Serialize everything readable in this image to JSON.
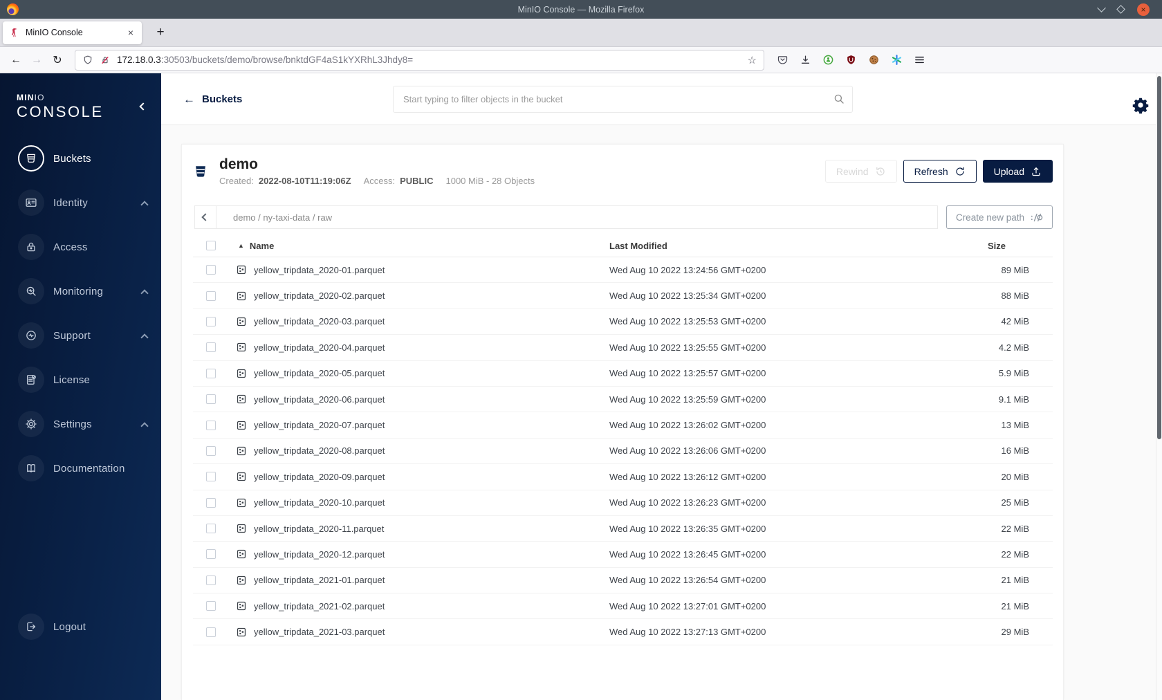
{
  "window": {
    "title": "MinIO Console — Mozilla Firefox"
  },
  "tab": {
    "title": "MinIO Console"
  },
  "urlbar": {
    "host": "172.18.0.3",
    "rest": ":30503/buckets/demo/browse/bnktdGF4aS1kYXRhL3Jhdy8="
  },
  "sidebar": {
    "logo": {
      "min": "MIN",
      "io": "IO",
      "console": "CONSOLE"
    },
    "items": [
      {
        "label": "Buckets",
        "icon": "buckets-icon",
        "active": true,
        "expandable": false
      },
      {
        "label": "Identity",
        "icon": "identity-icon",
        "active": false,
        "expandable": true
      },
      {
        "label": "Access",
        "icon": "access-lock-icon",
        "active": false,
        "expandable": false
      },
      {
        "label": "Monitoring",
        "icon": "monitoring-icon",
        "active": false,
        "expandable": true
      },
      {
        "label": "Support",
        "icon": "support-icon",
        "active": false,
        "expandable": true
      },
      {
        "label": "License",
        "icon": "license-icon",
        "active": false,
        "expandable": false
      },
      {
        "label": "Settings",
        "icon": "settings-gear-icon",
        "active": false,
        "expandable": true
      },
      {
        "label": "Documentation",
        "icon": "documentation-icon",
        "active": false,
        "expandable": false
      }
    ],
    "logout": {
      "label": "Logout",
      "icon": "logout-icon"
    }
  },
  "topbar": {
    "back_label": "Buckets",
    "search_placeholder": "Start typing to filter objects in the bucket"
  },
  "bucket": {
    "name": "demo",
    "created_label": "Created:",
    "created_value": "2022-08-10T11:19:06Z",
    "access_label": "Access:",
    "access_value": "PUBLIC",
    "usage": "1000 MiB - 28 Objects",
    "rewind_label": "Rewind",
    "refresh_label": "Refresh",
    "upload_label": "Upload"
  },
  "path": {
    "breadcrumb": "demo / ny-taxi-data / raw",
    "create_label": "Create new path"
  },
  "table": {
    "columns": {
      "name": "Name",
      "modified": "Last Modified",
      "size": "Size"
    },
    "rows": [
      {
        "name": "yellow_tripdata_2020-01.parquet",
        "modified": "Wed Aug 10 2022 13:24:56 GMT+0200",
        "size": "89 MiB"
      },
      {
        "name": "yellow_tripdata_2020-02.parquet",
        "modified": "Wed Aug 10 2022 13:25:34 GMT+0200",
        "size": "88 MiB"
      },
      {
        "name": "yellow_tripdata_2020-03.parquet",
        "modified": "Wed Aug 10 2022 13:25:53 GMT+0200",
        "size": "42 MiB"
      },
      {
        "name": "yellow_tripdata_2020-04.parquet",
        "modified": "Wed Aug 10 2022 13:25:55 GMT+0200",
        "size": "4.2 MiB"
      },
      {
        "name": "yellow_tripdata_2020-05.parquet",
        "modified": "Wed Aug 10 2022 13:25:57 GMT+0200",
        "size": "5.9 MiB"
      },
      {
        "name": "yellow_tripdata_2020-06.parquet",
        "modified": "Wed Aug 10 2022 13:25:59 GMT+0200",
        "size": "9.1 MiB"
      },
      {
        "name": "yellow_tripdata_2020-07.parquet",
        "modified": "Wed Aug 10 2022 13:26:02 GMT+0200",
        "size": "13 MiB"
      },
      {
        "name": "yellow_tripdata_2020-08.parquet",
        "modified": "Wed Aug 10 2022 13:26:06 GMT+0200",
        "size": "16 MiB"
      },
      {
        "name": "yellow_tripdata_2020-09.parquet",
        "modified": "Wed Aug 10 2022 13:26:12 GMT+0200",
        "size": "20 MiB"
      },
      {
        "name": "yellow_tripdata_2020-10.parquet",
        "modified": "Wed Aug 10 2022 13:26:23 GMT+0200",
        "size": "25 MiB"
      },
      {
        "name": "yellow_tripdata_2020-11.parquet",
        "modified": "Wed Aug 10 2022 13:26:35 GMT+0200",
        "size": "22 MiB"
      },
      {
        "name": "yellow_tripdata_2020-12.parquet",
        "modified": "Wed Aug 10 2022 13:26:45 GMT+0200",
        "size": "22 MiB"
      },
      {
        "name": "yellow_tripdata_2021-01.parquet",
        "modified": "Wed Aug 10 2022 13:26:54 GMT+0200",
        "size": "21 MiB"
      },
      {
        "name": "yellow_tripdata_2021-02.parquet",
        "modified": "Wed Aug 10 2022 13:27:01 GMT+0200",
        "size": "21 MiB"
      },
      {
        "name": "yellow_tripdata_2021-03.parquet",
        "modified": "Wed Aug 10 2022 13:27:13 GMT+0200",
        "size": "29 MiB"
      }
    ]
  },
  "colors": {
    "brand_navy": "#081C42",
    "sidebar_gradient_start": "#061531",
    "sidebar_gradient_end": "#0d2a55"
  }
}
